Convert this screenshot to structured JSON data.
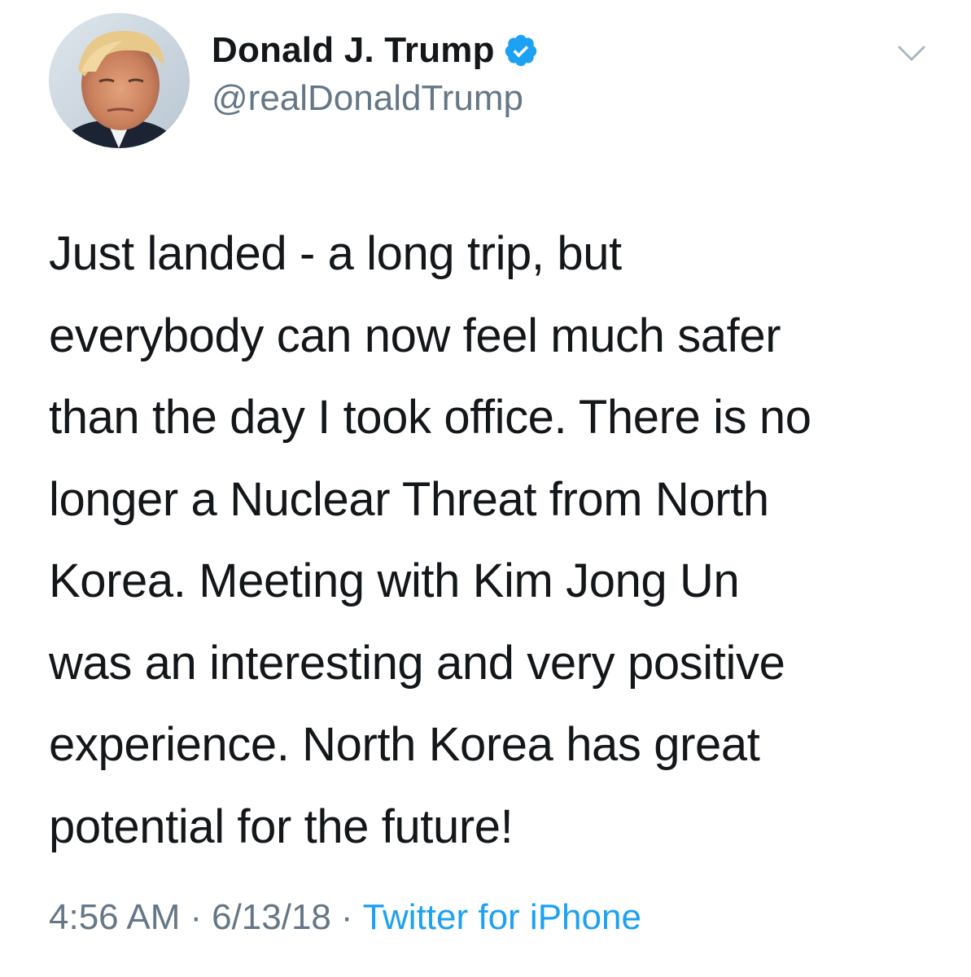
{
  "author": {
    "display_name": "Donald J. Trump",
    "handle": "@realDonaldTrump",
    "verified": true,
    "verified_color": "#1da1f2"
  },
  "icons": {
    "avatar": "profile-photo",
    "verified": "verified-badge-icon",
    "menu": "chevron-down-icon"
  },
  "tweet": {
    "lines": [
      "Just landed - a long trip, but",
      "everybody can now feel much safer",
      "than the day I took office. There is no",
      "longer a Nuclear Threat from North",
      "Korea. Meeting with Kim Jong Un",
      "was an interesting and very positive",
      "experience. North Korea has great",
      "potential for the future!"
    ]
  },
  "meta": {
    "time": "4:56 AM",
    "separator": "·",
    "date": "6/13/18",
    "source": "Twitter for iPhone"
  },
  "colors": {
    "text": "#14171a",
    "secondary": "#657786",
    "link": "#1da1f2"
  }
}
